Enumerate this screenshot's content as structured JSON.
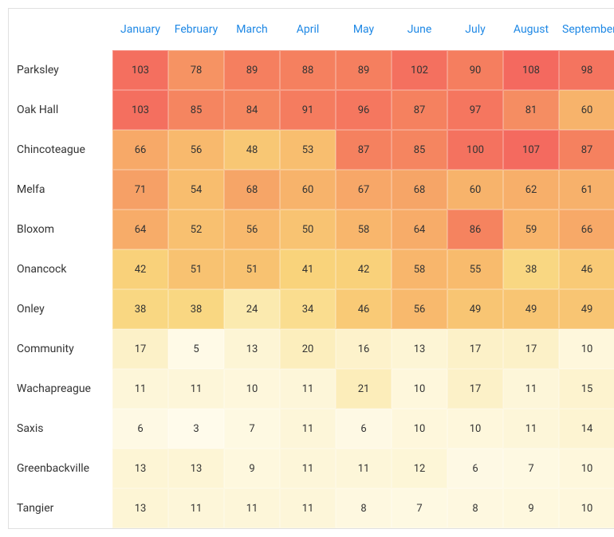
{
  "chart_data": {
    "type": "heatmap",
    "title": "",
    "columns": [
      "January",
      "February",
      "March",
      "April",
      "May",
      "June",
      "July",
      "August",
      "September"
    ],
    "rows": [
      "Parksley",
      "Oak Hall",
      "Chincoteague",
      "Melfa",
      "Bloxom",
      "Onancock",
      "Onley",
      "Community",
      "Wachapreague",
      "Saxis",
      "Greenbackville",
      "Tangier"
    ],
    "values": [
      [
        103,
        78,
        89,
        88,
        89,
        102,
        90,
        108,
        98
      ],
      [
        103,
        85,
        84,
        91,
        96,
        87,
        97,
        81,
        60
      ],
      [
        66,
        56,
        48,
        53,
        87,
        85,
        100,
        107,
        87
      ],
      [
        71,
        54,
        68,
        60,
        67,
        68,
        60,
        62,
        61
      ],
      [
        64,
        52,
        56,
        50,
        58,
        64,
        86,
        59,
        66
      ],
      [
        42,
        51,
        51,
        41,
        42,
        58,
        55,
        38,
        46
      ],
      [
        38,
        38,
        24,
        34,
        46,
        56,
        49,
        49,
        49
      ],
      [
        17,
        5,
        13,
        20,
        16,
        13,
        17,
        17,
        10
      ],
      [
        11,
        11,
        10,
        11,
        21,
        10,
        17,
        11,
        15
      ],
      [
        6,
        3,
        7,
        11,
        6,
        10,
        10,
        11,
        14
      ],
      [
        13,
        13,
        9,
        11,
        11,
        12,
        6,
        7,
        10
      ],
      [
        13,
        11,
        11,
        11,
        8,
        7,
        8,
        9,
        10
      ]
    ],
    "color_scale": {
      "min": 3,
      "max": 108,
      "low_color": "#fffbeb",
      "high_color": "#f4695f"
    }
  }
}
